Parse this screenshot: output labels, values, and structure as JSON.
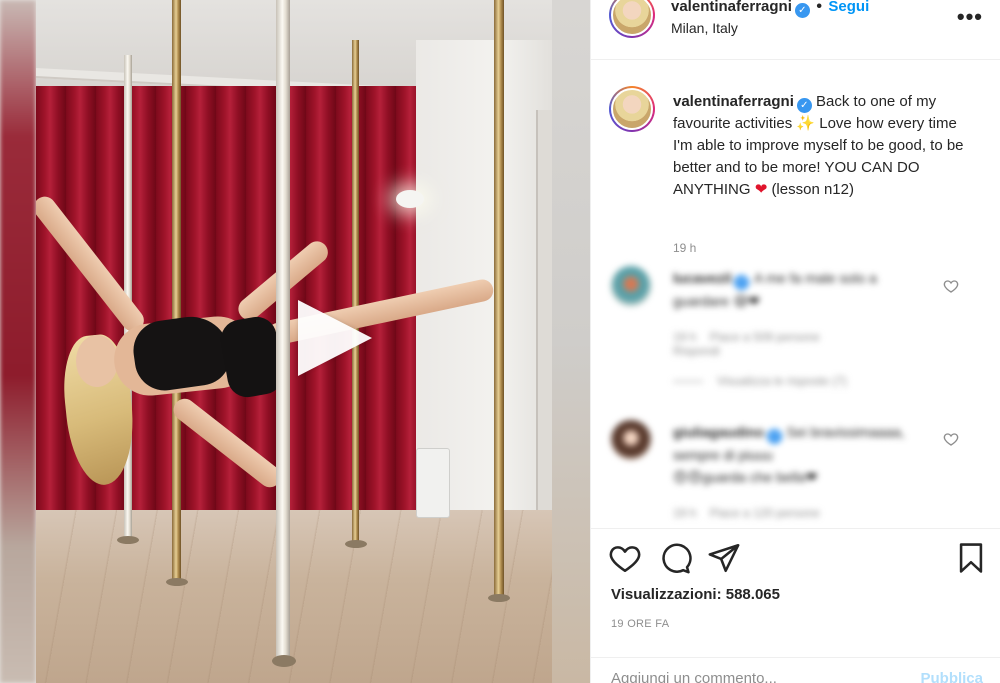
{
  "post": {
    "author": "valentinaferragni",
    "verified_mark": "✓",
    "separator": "•",
    "follow_label": "Segui",
    "location": "Milan, Italy",
    "more_label": "•••",
    "caption": {
      "text_before_sparkle": "Back to one of my favourite activities",
      "sparkle_emoji": "✨",
      "text_middle": "Love how every time I'm able to improve myself to be good, to be better and to be more! YOU CAN DO ANYTHING",
      "heart_emoji": "❤",
      "text_after": "(lesson n12)",
      "time": "19 h"
    }
  },
  "comments": [
    {
      "user": "lucavezil",
      "text": "A me fa male solo a guardare",
      "emoji": "😅❤",
      "time": "19 h",
      "likes": "Piace a 509 persone",
      "reply_label": "Rispondi",
      "view_replies": "Visualizza le risposte (7)"
    },
    {
      "user": "giuliagaudino",
      "text": "Sei bravissimaaaa, sempre di piuuu",
      "emoji_line": "😍😍guarda che bella❤",
      "time": "19 h",
      "likes": "Piace a 120 persone"
    }
  ],
  "stats": {
    "views": "Visualizzazioni: 588.065",
    "timestamp": "19 ORE FA"
  },
  "composer": {
    "placeholder": "Aggiungi un commento...",
    "publish_label": "Pubblica"
  },
  "icons": {
    "like": "heart-icon",
    "comment": "comment-bubble-icon",
    "share": "paper-plane-icon",
    "save": "bookmark-icon",
    "play": "play-icon"
  },
  "colors": {
    "link": "#0095f6",
    "verified": "#3897f0",
    "muted": "#8e8e8e",
    "publish_disabled": "#b2dffc"
  }
}
